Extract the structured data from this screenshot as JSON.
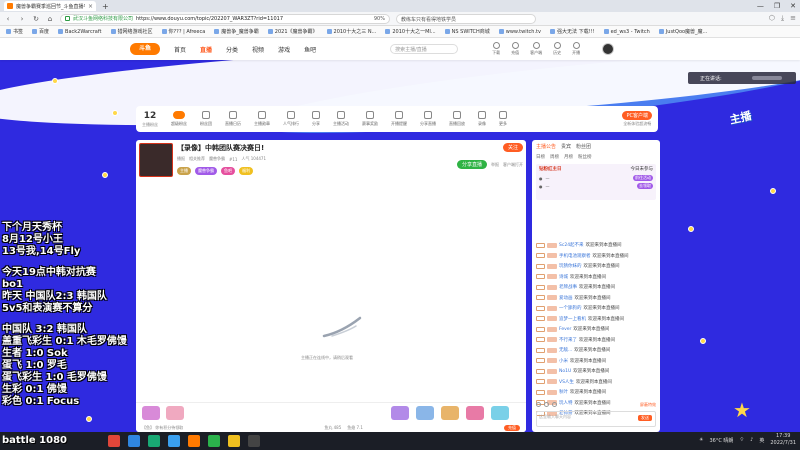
{
  "browser": {
    "tab_title": "魔兽争霸赛季巡回节_斗鱼直播平台",
    "new_tab": "+",
    "window_controls": [
      "—",
      "❐",
      "✕"
    ],
    "url_cert": "武汉斗鱼网络科技有限公司",
    "url": "https://www.douyu.com/topic/202207_WAR3ZT?rid=11017",
    "zoom": "90%",
    "search": "教练车只有看得地铁学员",
    "bookmarks": [
      "书签",
      "百度",
      "Back2Warcraft",
      "猎网络游戏社区",
      "你??? | Afreeca",
      "魔兽争_魔兽争霸",
      "2021《魔兽争霸》",
      "2010十大之三 N...",
      "2010十大之一MI...",
      "NS SWITCH商城",
      "www.twitch.tv",
      "强大无法 下载!!!",
      "ed_ws3 - Twitch",
      "JustQoo魔兽_魔..."
    ]
  },
  "site": {
    "logo": "斗鱼",
    "nav": [
      "首页",
      "直播",
      "分类",
      "视频",
      "游戏",
      "鱼吧"
    ],
    "active_nav": "直播",
    "search_placeholder": "搜索主播/直播",
    "head_icons": [
      "下载",
      "充值",
      "客户端",
      "历史",
      "开播"
    ]
  },
  "catbar": {
    "fans_count": "12",
    "fans_label": "主播粉丝",
    "items": [
      "超级粉丝",
      "粉丝团",
      "直播日历",
      "主播勋章",
      "人气排行",
      "分享",
      "主播活动",
      "赛事奖励",
      "开播提醒",
      "分享直播",
      "直播回放",
      "录像",
      "更多"
    ],
    "pc_button": "PC客户端",
    "pc_sub": "全新体验超流畅"
  },
  "player": {
    "title": "【录像】中韩团队赛决赛日!",
    "sub": [
      "播报",
      "相关推荐",
      "魔兽争霸",
      "#11"
    ],
    "hot": "人气 104471",
    "tags": [
      "主播",
      "魔兽争霸",
      "鱼吧",
      "福利"
    ],
    "follow": "关注",
    "share": "分享直播",
    "right_links": [
      "举报",
      "客户端打开"
    ],
    "loading": "主播正在连线中，请稍后观看",
    "bottom": [
      "【鱼】 你有积分待领取",
      "鱼丸 485",
      "鱼翅 7.1"
    ],
    "recharge": "充值"
  },
  "chat": {
    "tabs": [
      "主播公告",
      "贵宾",
      "粉丝团"
    ],
    "rank_tabs": [
      "日榜",
      "周榜",
      "月榜",
      "粉丝榜"
    ],
    "rank_title": "钻粉红主日",
    "rank_extra": "今日未参与",
    "rank_items": [
      "前往活动",
      "去领取"
    ],
    "messages": [
      {
        "user": "Sc24起不来",
        "text": "欢迎来到本直播间"
      },
      {
        "user": "手机电池观察者",
        "text": "欢迎来到本直播间"
      },
      {
        "user": "玩猜你妹的",
        "text": "欢迎来到本直播间"
      },
      {
        "user": "诗城",
        "text": "欢迎来到本直播间"
      },
      {
        "user": "老牌战事",
        "text": "欢迎来到本直播间"
      },
      {
        "user": "爱动画",
        "text": "欢迎来到本直播间"
      },
      {
        "user": "一个舔狗的",
        "text": "欢迎来到本直播间"
      },
      {
        "user": "追梦一上看机",
        "text": "欢迎来到本直播间"
      },
      {
        "user": "Fever",
        "text": "欢迎来到本直播间"
      },
      {
        "user": "不行来了",
        "text": "欢迎来到本直播间"
      },
      {
        "user": "无敌...",
        "text": "欢迎来到本直播间"
      },
      {
        "user": "小米",
        "text": "欢迎来到本直播间"
      },
      {
        "user": "No1U",
        "text": "欢迎来到本直播间"
      },
      {
        "user": "VS人生",
        "text": "欢迎来到本直播间"
      },
      {
        "user": "秋叶",
        "text": "欢迎来到本直播间"
      },
      {
        "user": "玩人特",
        "text": "欢迎来到本直播间"
      },
      {
        "user": "老帅哥",
        "text": "欢迎来到本直播间"
      }
    ],
    "block_tip": "屏蔽特效",
    "input_placeholder": "这里输入聊天内容",
    "send": "发送"
  },
  "overlay": {
    "lines_a": [
      "下个月天秀杯",
      "8月12号小王",
      "13号我,14号Fly"
    ],
    "lines_b": [
      "今天19点中韩对抗赛",
      "bo1",
      "昨天 中国队2:3 韩国队",
      "5v5和表演赛不算分"
    ],
    "lines_c": [
      "中国队      3:2 韩国队",
      "盖重飞彩生 0:1 木毛罗佛馒",
      "生者          1:0 Sok",
      "蛋飞          1:0 罗毛",
      "蛋飞彩生    1:0 毛罗佛馒",
      "生彩          0:1 佛馒",
      "彩色          0:1 Focus"
    ],
    "score": "battle  1080"
  },
  "side": {
    "speaking": "正在讲话:",
    "logo": "主播"
  },
  "taskbar": {
    "weather": "36°C 晴朗",
    "time": "17:39",
    "date": "2022/7/31",
    "lang": "英"
  },
  "colors": {
    "accent": "#ff5d23",
    "page_bg": "#2f2ae0",
    "taskbar": "#1b1e26"
  }
}
